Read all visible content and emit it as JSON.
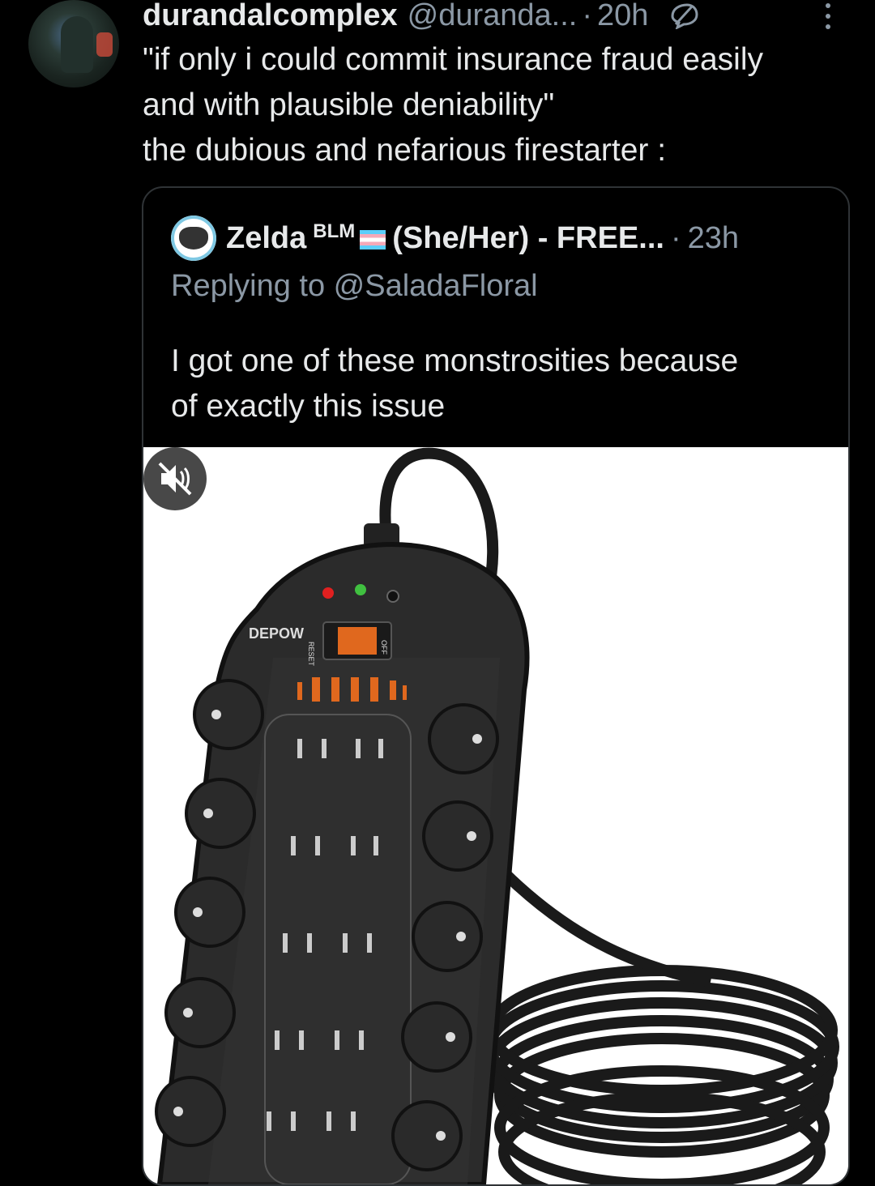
{
  "tweet": {
    "username": "durandalcomplex",
    "handle": "@duranda...",
    "separator": "·",
    "time": "20h",
    "text_lines": [
      "\"if only i could commit insurance fraud easily",
      "and with plausible deniability\"",
      "the dubious and nefarious firestarter :"
    ]
  },
  "quoted": {
    "name": "Zelda",
    "badge": "BLM",
    "pronouns": "(She/Her) - FREE...",
    "separator": "·",
    "time": "23h",
    "replying_to": "Replying to @SaladaFloral",
    "text_lines": [
      "I got one of these monstrosities because",
      "of exactly this issue"
    ],
    "media": {
      "brand": "DEPOW",
      "switch_left": "RESET",
      "switch_right": "OFF"
    }
  },
  "icons": {
    "reply": "reply-icon",
    "more": "more-vertical-icon",
    "mute": "speaker-muted-icon"
  }
}
